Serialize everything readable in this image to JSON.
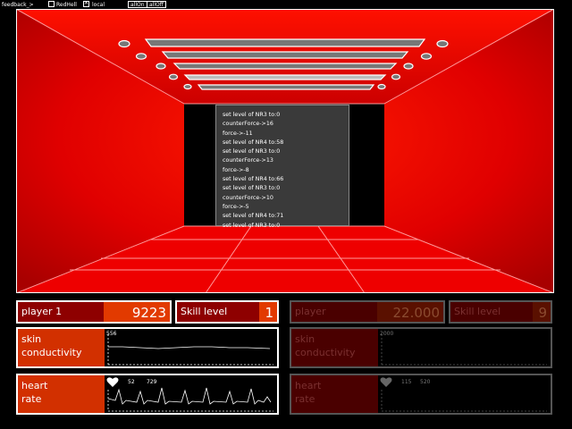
{
  "topbar": {
    "feedback_label": "feedback_>",
    "redhell_label": "RedHell",
    "redhell_checked": false,
    "local_label": "local",
    "local_checked": true,
    "all_on_label": "allOn",
    "all_off_label": "allOff"
  },
  "scene": {
    "wall_color": "#e00000",
    "floor_color": "#ee0000",
    "log_lines": [
      "set level of NR3 to:0",
      "counterForce->16",
      "force->-11",
      "set level of NR4 to:58",
      "set level of NR3 to:0",
      "counterForce->13",
      "force->-8",
      "set level of NR4 to:66",
      "set level of NR3 to:0",
      "counterForce->10",
      "force->-5",
      "set level of NR4 to:71",
      "set level of NR3 to:0"
    ]
  },
  "player1": {
    "name": "player 1",
    "score": "9223",
    "skill_label": "Skill level",
    "skill_value": "1",
    "skin_label_line1": "skin",
    "skin_label_line2": "conductivity",
    "skin_value": "556",
    "heart_label_line1": "heart",
    "heart_label_line2": "rate",
    "heart_value_1": "52",
    "heart_value_2": "729"
  },
  "player2": {
    "name": "player",
    "score": "22.000",
    "skill_label": "Skill level",
    "skill_value": "9",
    "skin_label_line1": "skin",
    "skin_label_line2": "conductivity",
    "skin_value": "2000",
    "heart_label_line1": "heart",
    "heart_label_line2": "rate",
    "heart_value_1": "115",
    "heart_value_2": "520"
  }
}
